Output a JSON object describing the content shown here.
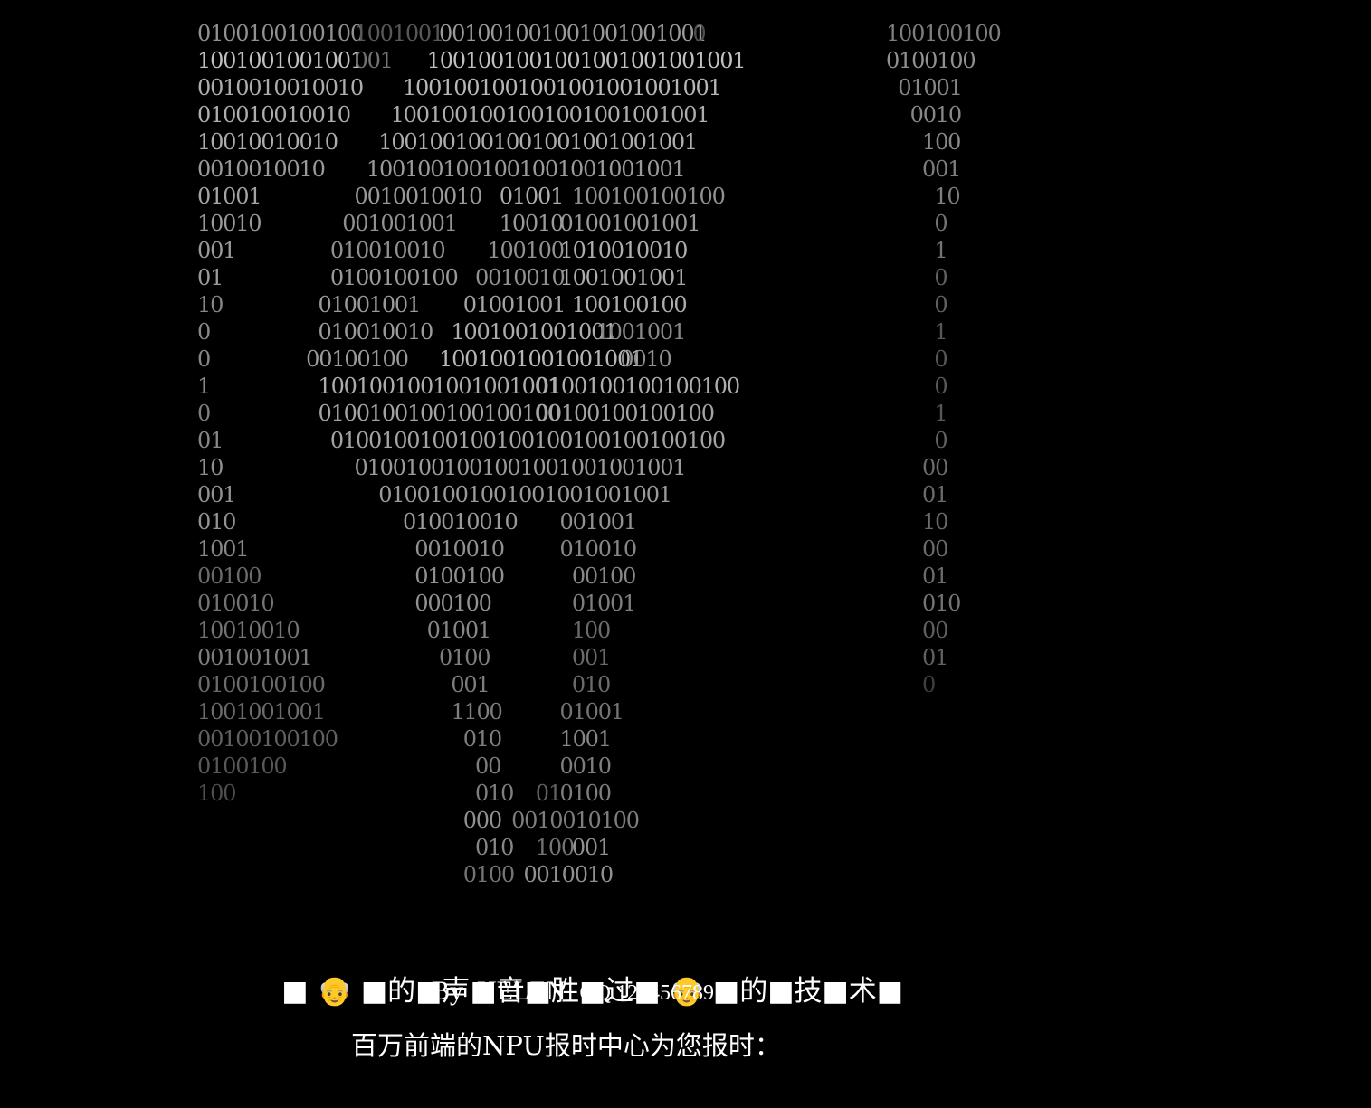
{
  "ascii_art": {
    "lines": [
      {
        "segs": [
          {
            "col": 0,
            "text": "0100100100100",
            "shade": 0.55
          },
          {
            "col": 13,
            "text": "1001001",
            "shade": 0.25
          },
          {
            "col": 20,
            "text": "001001001001001001001",
            "shade": 0.6
          },
          {
            "col": 41,
            "text": "0",
            "shade": 0.2
          },
          {
            "col": 57,
            "text": "100100100",
            "shade": 0.45
          }
        ]
      },
      {
        "segs": [
          {
            "col": 0,
            "text": "1001001001001",
            "shade": 0.8
          },
          {
            "col": 13,
            "text": "001",
            "shade": 0.4
          },
          {
            "col": 19,
            "text": "1001001001001001001001001",
            "shade": 0.8
          },
          {
            "col": 57,
            "text": "0100100",
            "shade": 0.55
          }
        ]
      },
      {
        "segs": [
          {
            "col": 0,
            "text": "0010010010010",
            "shade": 0.7
          },
          {
            "col": 17,
            "text": "1001001001001001001001001",
            "shade": 0.75
          },
          {
            "col": 58,
            "text": "01001",
            "shade": 0.5
          }
        ]
      },
      {
        "segs": [
          {
            "col": 0,
            "text": "010010010010",
            "shade": 0.7
          },
          {
            "col": 16,
            "text": "1001001001001001001001001",
            "shade": 0.7
          },
          {
            "col": 59,
            "text": "0010",
            "shade": 0.5
          }
        ]
      },
      {
        "segs": [
          {
            "col": 0,
            "text": "10010010010",
            "shade": 0.7
          },
          {
            "col": 15,
            "text": "1001001001001001001001001",
            "shade": 0.7
          },
          {
            "col": 60,
            "text": "100",
            "shade": 0.5
          }
        ]
      },
      {
        "segs": [
          {
            "col": 0,
            "text": "0010010010",
            "shade": 0.6
          },
          {
            "col": 14,
            "text": "1001001001001001001001001",
            "shade": 0.6
          },
          {
            "col": 60,
            "text": "001",
            "shade": 0.45
          }
        ]
      },
      {
        "segs": [
          {
            "col": 0,
            "text": "01001",
            "shade": 0.65
          },
          {
            "col": 13,
            "text": "0010010010",
            "shade": 0.6
          },
          {
            "col": 25,
            "text": "01001",
            "shade": 0.7
          },
          {
            "col": 31,
            "text": "100100100100",
            "shade": 0.55
          },
          {
            "col": 61,
            "text": "10",
            "shade": 0.45
          }
        ]
      },
      {
        "segs": [
          {
            "col": 0,
            "text": "10010",
            "shade": 0.6
          },
          {
            "col": 12,
            "text": "001001001",
            "shade": 0.55
          },
          {
            "col": 25,
            "text": "10010",
            "shade": 0.6
          },
          {
            "col": 30,
            "text": "01001001001",
            "shade": 0.6
          },
          {
            "col": 61,
            "text": "0",
            "shade": 0.4
          }
        ]
      },
      {
        "segs": [
          {
            "col": 0,
            "text": "001",
            "shade": 0.6
          },
          {
            "col": 11,
            "text": "010010010",
            "shade": 0.55
          },
          {
            "col": 24,
            "text": "100100",
            "shade": 0.55
          },
          {
            "col": 30,
            "text": "1010010010",
            "shade": 0.7
          },
          {
            "col": 61,
            "text": "1",
            "shade": 0.4
          }
        ]
      },
      {
        "segs": [
          {
            "col": 0,
            "text": "01",
            "shade": 0.6
          },
          {
            "col": 11,
            "text": "0100100100",
            "shade": 0.6
          },
          {
            "col": 23,
            "text": "0010010",
            "shade": 0.55
          },
          {
            "col": 30,
            "text": "1001001001",
            "shade": 0.7
          },
          {
            "col": 61,
            "text": "0",
            "shade": 0.3
          }
        ]
      },
      {
        "segs": [
          {
            "col": 0,
            "text": "10",
            "shade": 0.5
          },
          {
            "col": 10,
            "text": "01001001",
            "shade": 0.6
          },
          {
            "col": 22,
            "text": "01001001",
            "shade": 0.65
          },
          {
            "col": 31,
            "text": "100100100",
            "shade": 0.7
          },
          {
            "col": 61,
            "text": "0",
            "shade": 0.3
          }
        ]
      },
      {
        "segs": [
          {
            "col": 0,
            "text": "0",
            "shade": 0.5
          },
          {
            "col": 10,
            "text": "010010010",
            "shade": 0.6
          },
          {
            "col": 21,
            "text": "1001001001001",
            "shade": 0.7
          },
          {
            "col": 33,
            "text": "1001001",
            "shade": 0.5
          },
          {
            "col": 61,
            "text": "1",
            "shade": 0.25
          }
        ]
      },
      {
        "segs": [
          {
            "col": 0,
            "text": "0",
            "shade": 0.5
          },
          {
            "col": 9,
            "text": "00100100",
            "shade": 0.6
          },
          {
            "col": 20,
            "text": "1001001001001001",
            "shade": 0.75
          },
          {
            "col": 35,
            "text": "0010",
            "shade": 0.55
          },
          {
            "col": 61,
            "text": "0",
            "shade": 0.25
          }
        ]
      },
      {
        "segs": [
          {
            "col": 0,
            "text": "1",
            "shade": 0.5
          },
          {
            "col": 10,
            "text": "1001001001001001001",
            "shade": 0.7
          },
          {
            "col": 28,
            "text": "0100100100100100",
            "shade": 0.7
          },
          {
            "col": 61,
            "text": "0",
            "shade": 0.25
          }
        ]
      },
      {
        "segs": [
          {
            "col": 0,
            "text": "0",
            "shade": 0.45
          },
          {
            "col": 10,
            "text": "0100100100100100100",
            "shade": 0.65
          },
          {
            "col": 28,
            "text": "00100100100100",
            "shade": 0.65
          },
          {
            "col": 61,
            "text": "1",
            "shade": 0.25
          }
        ]
      },
      {
        "segs": [
          {
            "col": 0,
            "text": "01",
            "shade": 0.5
          },
          {
            "col": 11,
            "text": "0100100100100100100100100100100",
            "shade": 0.65
          },
          {
            "col": 61,
            "text": "0",
            "shade": 0.3
          }
        ]
      },
      {
        "segs": [
          {
            "col": 0,
            "text": "10",
            "shade": 0.55
          },
          {
            "col": 13,
            "text": "01001001001001001001001001",
            "shade": 0.6
          },
          {
            "col": 60,
            "text": "00",
            "shade": 0.35
          }
        ]
      },
      {
        "segs": [
          {
            "col": 0,
            "text": "001",
            "shade": 0.55
          },
          {
            "col": 15,
            "text": "01001001001001001001001",
            "shade": 0.6
          },
          {
            "col": 60,
            "text": "01",
            "shade": 0.35
          }
        ]
      },
      {
        "segs": [
          {
            "col": 0,
            "text": "010",
            "shade": 0.55
          },
          {
            "col": 17,
            "text": "010010010",
            "shade": 0.6
          },
          {
            "col": 30,
            "text": "001001",
            "shade": 0.55
          },
          {
            "col": 60,
            "text": "10",
            "shade": 0.35
          }
        ]
      },
      {
        "segs": [
          {
            "col": 0,
            "text": "1001",
            "shade": 0.5
          },
          {
            "col": 18,
            "text": "0010010",
            "shade": 0.55
          },
          {
            "col": 30,
            "text": "010010",
            "shade": 0.5
          },
          {
            "col": 60,
            "text": "00",
            "shade": 0.35
          }
        ]
      },
      {
        "segs": [
          {
            "col": 0,
            "text": "00100",
            "shade": 0.35
          },
          {
            "col": 18,
            "text": "0100100",
            "shade": 0.55
          },
          {
            "col": 31,
            "text": "00100",
            "shade": 0.5
          },
          {
            "col": 60,
            "text": "01",
            "shade": 0.35
          }
        ]
      },
      {
        "segs": [
          {
            "col": 0,
            "text": "010010",
            "shade": 0.4
          },
          {
            "col": 18,
            "text": "000100",
            "shade": 0.55
          },
          {
            "col": 31,
            "text": "01001",
            "shade": 0.45
          },
          {
            "col": 60,
            "text": "010",
            "shade": 0.4
          }
        ]
      },
      {
        "segs": [
          {
            "col": 0,
            "text": "10010010",
            "shade": 0.4
          },
          {
            "col": 19,
            "text": "01001",
            "shade": 0.5
          },
          {
            "col": 31,
            "text": "100",
            "shade": 0.35
          },
          {
            "col": 60,
            "text": "00",
            "shade": 0.3
          }
        ]
      },
      {
        "segs": [
          {
            "col": 0,
            "text": "001001001",
            "shade": 0.45
          },
          {
            "col": 20,
            "text": "0100",
            "shade": 0.45
          },
          {
            "col": 31,
            "text": "001",
            "shade": 0.35
          },
          {
            "col": 60,
            "text": "01",
            "shade": 0.3
          }
        ]
      },
      {
        "segs": [
          {
            "col": 0,
            "text": "0100100100",
            "shade": 0.35
          },
          {
            "col": 21,
            "text": "001",
            "shade": 0.45
          },
          {
            "col": 31,
            "text": "010",
            "shade": 0.35
          },
          {
            "col": 60,
            "text": "0",
            "shade": 0.12
          }
        ]
      },
      {
        "segs": [
          {
            "col": 0,
            "text": "1001001001",
            "shade": 0.35
          },
          {
            "col": 21,
            "text": "1100",
            "shade": 0.45
          },
          {
            "col": 30,
            "text": "01001",
            "shade": 0.4
          }
        ]
      },
      {
        "segs": [
          {
            "col": 0,
            "text": "00100100100",
            "shade": 0.3
          },
          {
            "col": 22,
            "text": "010",
            "shade": 0.45
          },
          {
            "col": 30,
            "text": "1001",
            "shade": 0.5
          }
        ]
      },
      {
        "segs": [
          {
            "col": 0,
            "text": "0100100",
            "shade": 0.25
          },
          {
            "col": 23,
            "text": "00",
            "shade": 0.45
          },
          {
            "col": 30,
            "text": "0010",
            "shade": 0.45
          }
        ]
      },
      {
        "segs": [
          {
            "col": 0,
            "text": "100",
            "shade": 0.2
          },
          {
            "col": 23,
            "text": "010",
            "shade": 0.45
          },
          {
            "col": 28,
            "text": "01",
            "shade": 0.3
          },
          {
            "col": 30,
            "text": "0100",
            "shade": 0.45
          }
        ]
      },
      {
        "segs": [
          {
            "col": 22,
            "text": "000",
            "shade": 0.55
          },
          {
            "col": 26,
            "text": "0010010100",
            "shade": 0.45
          }
        ]
      },
      {
        "segs": [
          {
            "col": 23,
            "text": "010",
            "shade": 0.5
          },
          {
            "col": 28,
            "text": "100",
            "shade": 0.4
          },
          {
            "col": 31,
            "text": "001",
            "shade": 0.55
          }
        ]
      },
      {
        "segs": [
          {
            "col": 22,
            "text": "0100",
            "shade": 0.4
          },
          {
            "col": 27,
            "text": "0010010",
            "shade": 0.55
          }
        ]
      }
    ]
  },
  "tagline": {
    "text": "■ 👴 ■的■声■音■胜■过■ 👴 ■的■技■术■"
  },
  "byline": {
    "author": "By  HELEN  ",
    "qq": "QQ 123456789"
  },
  "clock": {
    "text": "百万前端的NPU报时中心为您报时："
  }
}
